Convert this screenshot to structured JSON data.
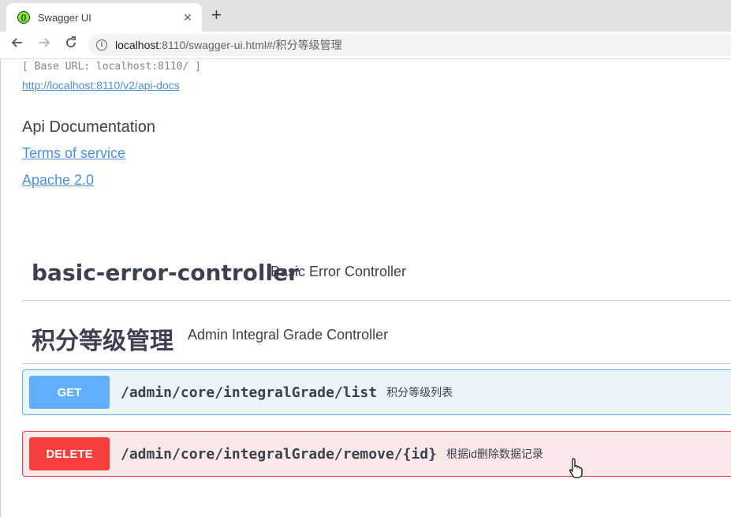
{
  "browser": {
    "tab_title": "Swagger UI",
    "tab_close": "✕",
    "new_tab": "+",
    "url_host": "localhost",
    "url_path": ":8110/swagger-ui.html#/积分等级管理",
    "back_icon": "arrow-left-icon",
    "forward_icon": "arrow-right-icon",
    "reload_icon": "reload-icon",
    "info_icon": "info-icon"
  },
  "info": {
    "base_url": "[ Base URL: localhost:8110/ ]",
    "api_docs_link": "http://localhost:8110/v2/api-docs",
    "description": "Api Documentation",
    "terms_link": "Terms of service",
    "license_link": "Apache 2.0"
  },
  "tags": [
    {
      "name": "basic-error-controller",
      "description": "Basic Error Controller"
    },
    {
      "name": "积分等级管理",
      "description": "Admin Integral Grade Controller"
    }
  ],
  "operations": [
    {
      "method": "GET",
      "path": "/admin/core/integralGrade/list",
      "summary": "积分等级列表",
      "color": "#61affe"
    },
    {
      "method": "DELETE",
      "path": "/admin/core/integralGrade/remove/{id}",
      "summary": "根据id删除数据记录",
      "color": "#f93e3e"
    }
  ]
}
